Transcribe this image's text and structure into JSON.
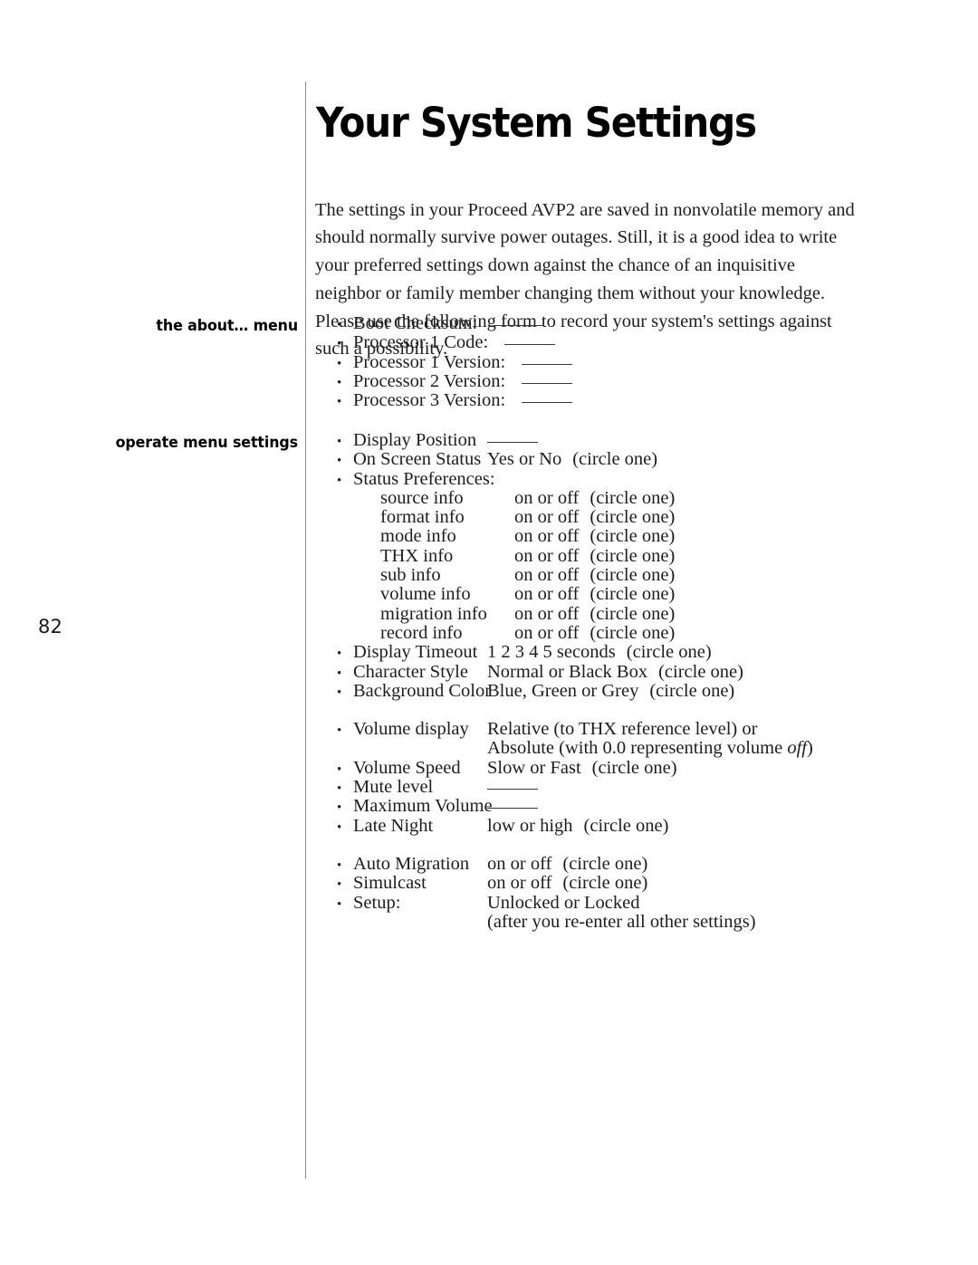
{
  "page": {
    "number": "82",
    "title": "Your System Settings",
    "intro": "The settings in your Proceed AVP2 are saved in nonvolatile memory and should normally survive power outages. Still, it is a good idea to write your preferred settings down against the chance of an inquisitive neighbor or family member changing them without your knowledge. Please use the following form to record your system's settings against such a possibility."
  },
  "sections": {
    "about": {
      "side_label": "the about… menu",
      "items": [
        {
          "label": "Boot Checksum:",
          "blank": true
        },
        {
          "label": "Processor 1 Code:",
          "blank": true
        },
        {
          "label": "Processor 1 Version:",
          "blank": true
        },
        {
          "label": "Processor 2 Version:",
          "blank": true
        },
        {
          "label": "Processor 3 Version:",
          "blank": true
        }
      ]
    },
    "operate": {
      "side_label": "operate menu settings",
      "items": {
        "display_position": {
          "label": "Display Position"
        },
        "on_screen_status": {
          "label": "On Screen Status",
          "value": "Yes or No",
          "note": "(circle one)"
        },
        "status_preferences": {
          "label": "Status Preferences:"
        },
        "sub": [
          {
            "label": "source info",
            "value": "on or off",
            "note": "(circle one)"
          },
          {
            "label": "format info",
            "value": "on or off",
            "note": "(circle one)"
          },
          {
            "label": "mode info",
            "value": "on or off",
            "note": "(circle one)"
          },
          {
            "label": "THX info",
            "value": "on or off",
            "note": "(circle one)"
          },
          {
            "label": "sub info",
            "value": "on or off",
            "note": "(circle one)"
          },
          {
            "label": "volume info",
            "value": "on or off",
            "note": "(circle one)"
          },
          {
            "label": "migration info",
            "value": "on or off",
            "note": "(circle one)"
          },
          {
            "label": "record info",
            "value": "on or off",
            "note": "(circle one)"
          }
        ],
        "display_timeout": {
          "label": "Display Timeout",
          "value": "1  2  3  4  5 seconds",
          "note": "(circle one)"
        },
        "character_style": {
          "label": "Character Style",
          "value": "Normal or Black Box",
          "note": "(circle one)"
        },
        "background_color": {
          "label": "Background Color",
          "value": "Blue, Green or Grey",
          "note": "(circle one)"
        },
        "volume_display": {
          "label": "Volume display",
          "value_line1": "Relative (to THX reference level) or",
          "value_line2_a": "Absolute (with 0.0 representing volume ",
          "value_line2_italic": "off",
          "value_line2_b": ")"
        },
        "volume_speed": {
          "label": "Volume Speed",
          "value": "Slow or Fast",
          "note": "(circle one)"
        },
        "mute_level": {
          "label": "Mute level"
        },
        "maximum_volume": {
          "label": "Maximum Volume"
        },
        "late_night": {
          "label": "Late Night",
          "value": "low or high",
          "note": "(circle one)"
        },
        "auto_migration": {
          "label": "Auto Migration",
          "value": "on or off",
          "note": "(circle one)"
        },
        "simulcast": {
          "label": "Simulcast",
          "value": "on or off",
          "note": "(circle one)"
        },
        "setup": {
          "label": "Setup:",
          "value": "Unlocked or Locked",
          "sub_note": "(after you re-enter all other settings)"
        }
      }
    }
  },
  "glyphs": {
    "bullet": "•"
  }
}
